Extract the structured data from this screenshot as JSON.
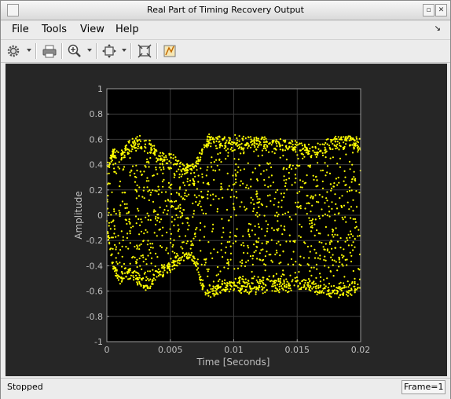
{
  "window": {
    "title": "Real Part of Timing Recovery Output"
  },
  "menu": {
    "file": "File",
    "tools": "Tools",
    "view": "View",
    "help": "Help"
  },
  "toolbar": {
    "icons": [
      "gear-icon",
      "print-icon",
      "zoom-in-icon",
      "fit-to-view-icon",
      "axes-scaling-icon",
      "style-icon"
    ]
  },
  "status": {
    "text": "Stopped",
    "frame": "Frame=1"
  },
  "colors": {
    "plot_bg": "#000000",
    "figure_bg": "#262626",
    "trace": "#ffff00",
    "grid": "#3a3a3a",
    "axis_text": "#bfbfbf"
  },
  "chart_data": {
    "type": "scatter",
    "xlabel": "Time [Seconds]",
    "ylabel": "Amplitude",
    "xlim": [
      0,
      0.02
    ],
    "ylim": [
      -1,
      1
    ],
    "xticks": [
      0,
      0.005,
      0.01,
      0.015,
      0.02
    ],
    "xtick_labels": [
      "0",
      "0.005",
      "0.01",
      "0.015",
      "0.02"
    ],
    "yticks": [
      -1,
      -0.8,
      -0.6,
      -0.4,
      -0.2,
      0,
      0.2,
      0.4,
      0.6,
      0.8,
      1
    ],
    "ytick_labels": [
      "-1",
      "-0.8",
      "-0.6",
      "-0.4",
      "-0.2",
      "0",
      "0.2",
      "0.4",
      "0.6",
      "0.8",
      "1"
    ],
    "grid": true,
    "series": [
      {
        "color": "#ffff00",
        "envelope": {
          "x": [
            0,
            0.0005,
            0.001,
            0.0015,
            0.002,
            0.0025,
            0.003,
            0.0035,
            0.004,
            0.0045,
            0.005,
            0.0055,
            0.006,
            0.0065,
            0.007,
            0.0075,
            0.008,
            0.0085,
            0.009,
            0.0095,
            0.01,
            0.011,
            0.012,
            0.013,
            0.014,
            0.015,
            0.016,
            0.017,
            0.018,
            0.019,
            0.02
          ],
          "upper": [
            0.4,
            0.52,
            0.5,
            0.55,
            0.6,
            0.63,
            0.62,
            0.58,
            0.5,
            0.48,
            0.5,
            0.45,
            0.4,
            0.4,
            0.42,
            0.55,
            0.63,
            0.62,
            0.63,
            0.63,
            0.63,
            0.64,
            0.62,
            0.6,
            0.6,
            0.58,
            0.55,
            0.58,
            0.62,
            0.64,
            0.6
          ],
          "lower": [
            -0.1,
            -0.45,
            -0.55,
            -0.5,
            -0.5,
            -0.55,
            -0.6,
            -0.58,
            -0.5,
            -0.48,
            -0.45,
            -0.4,
            -0.35,
            -0.35,
            -0.4,
            -0.6,
            -0.65,
            -0.63,
            -0.62,
            -0.6,
            -0.6,
            -0.62,
            -0.62,
            -0.6,
            -0.6,
            -0.58,
            -0.6,
            -0.63,
            -0.64,
            -0.65,
            -0.62
          ]
        }
      }
    ]
  }
}
